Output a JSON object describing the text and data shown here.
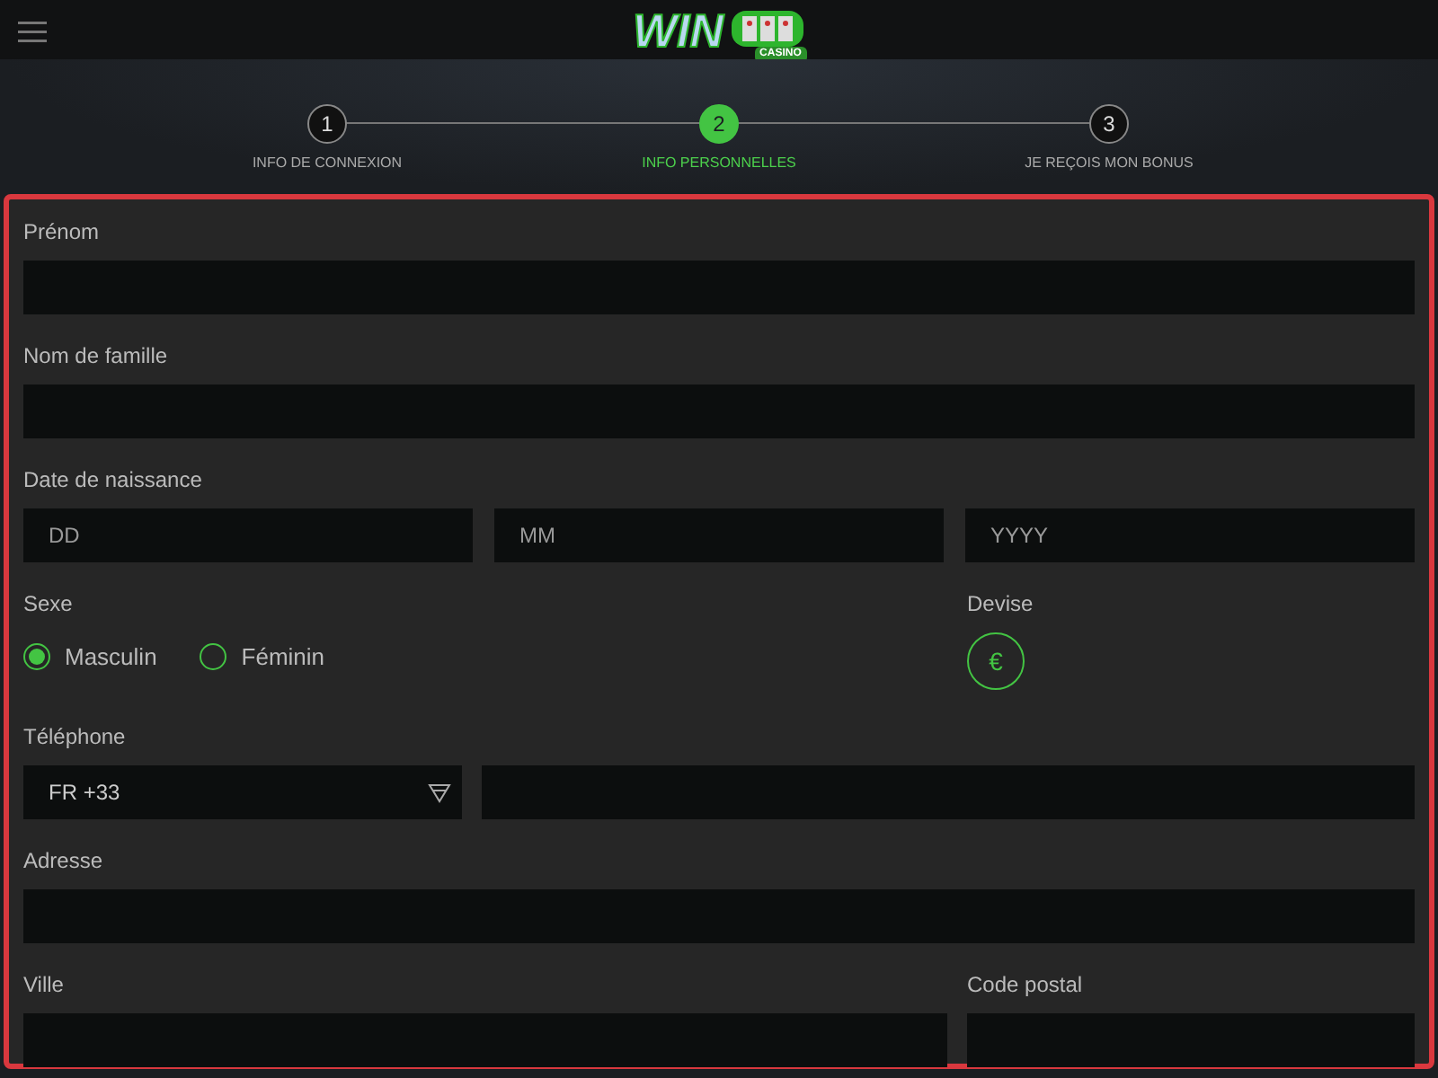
{
  "header": {
    "logo": {
      "word": "WIN",
      "tagline": "CASINO"
    }
  },
  "steps": [
    {
      "number": "1",
      "label": "INFO DE CONNEXION",
      "selected": false
    },
    {
      "number": "2",
      "label": "INFO PERSONNELLES",
      "selected": true
    },
    {
      "number": "3",
      "label": "JE REÇOIS MON BONUS",
      "selected": false
    }
  ],
  "form": {
    "rows": [
      {
        "kind": "text",
        "label": "Prénom"
      },
      {
        "kind": "text",
        "label": "Nom de famille"
      },
      {
        "kind": "date",
        "label": "Date de naissance",
        "placeholders": [
          "DD",
          "MM",
          "YYYY"
        ]
      },
      {
        "kind": "gender",
        "label": "Sexe",
        "options": [
          {
            "label": "Masculin",
            "selected": true
          },
          {
            "label": "Féminin",
            "selected": false
          }
        ],
        "currency_label": "Devise",
        "currency_symbol": "€"
      },
      {
        "kind": "phone",
        "label": "Téléphone",
        "prefix": "FR +33"
      },
      {
        "kind": "text",
        "label": "Adresse"
      },
      {
        "kind": "pair",
        "labels": [
          "Ville",
          "Code postal"
        ]
      }
    ]
  }
}
